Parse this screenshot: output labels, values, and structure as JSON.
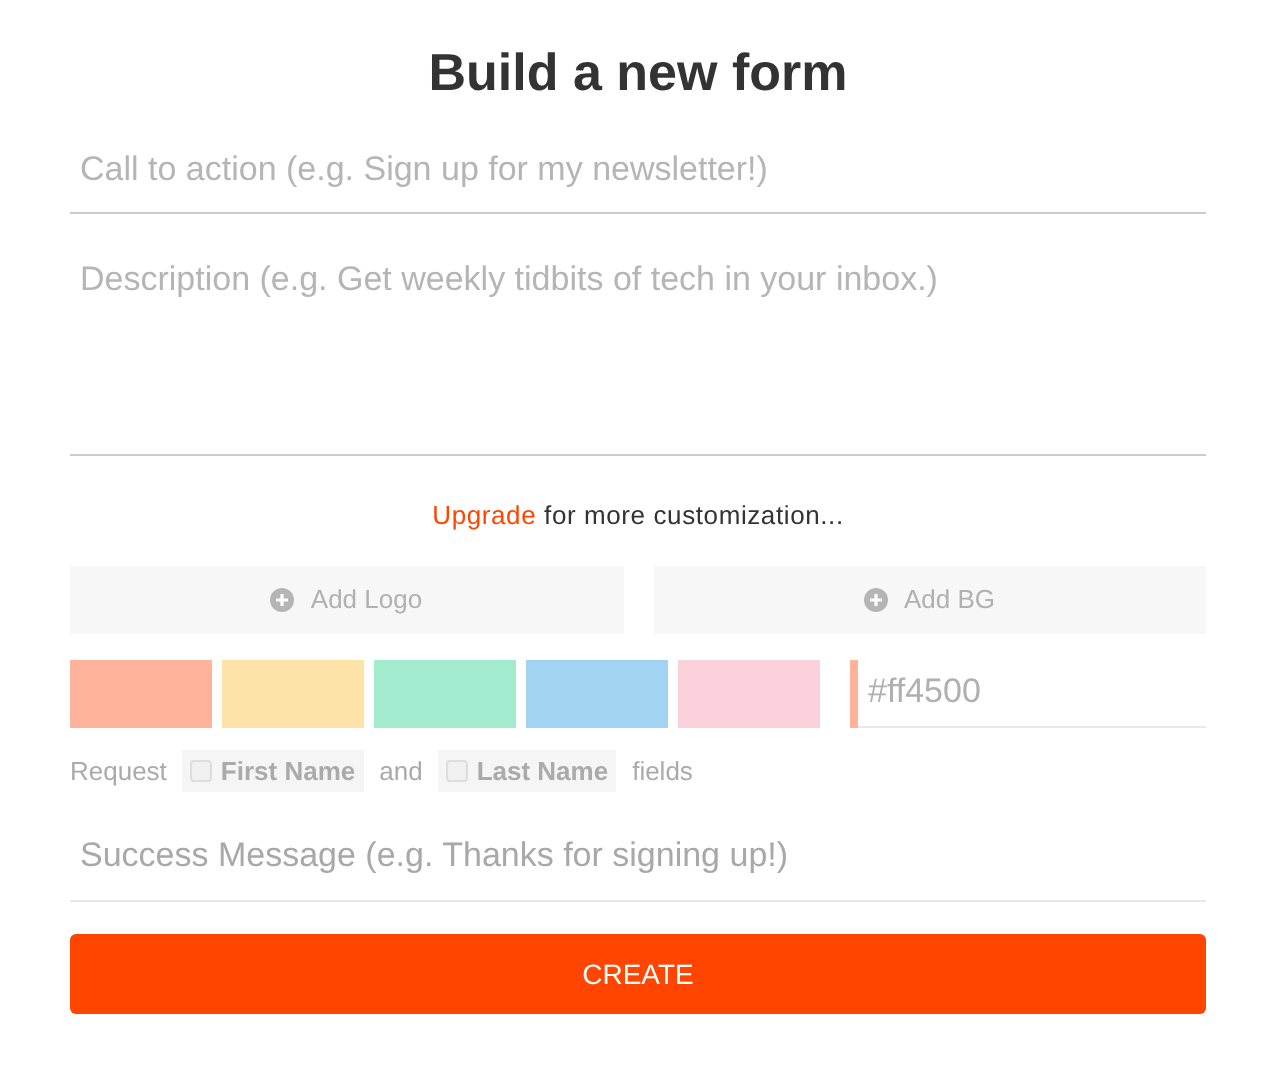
{
  "title": "Build a new form",
  "call_to_action": {
    "placeholder": "Call to action (e.g. Sign up for my newsletter!)"
  },
  "description": {
    "placeholder": "Description (e.g. Get weekly tidbits of tech in your inbox.)"
  },
  "upgrade": {
    "link": "Upgrade",
    "text": "for more customization..."
  },
  "media_buttons": [
    "Add Logo",
    "Add BG"
  ],
  "swatches": [
    {
      "color": "#ffb39a"
    },
    {
      "color": "#fde3a7"
    },
    {
      "color": "#a3ebcf"
    },
    {
      "color": "#a3d3f3"
    },
    {
      "color": "#fbd2dc"
    }
  ],
  "hex_field": {
    "placeholder": "#ff4500",
    "color": "#ffb39a"
  },
  "request": {
    "prefix": "Request",
    "joiner": "and",
    "suffix": "fields",
    "options": [
      {
        "label": "First Name",
        "checked": false
      },
      {
        "label": "Last Name",
        "checked": false
      }
    ]
  },
  "success_message": {
    "placeholder": "Success Message (e.g. Thanks for signing up!)"
  },
  "create_button": "CREATE"
}
